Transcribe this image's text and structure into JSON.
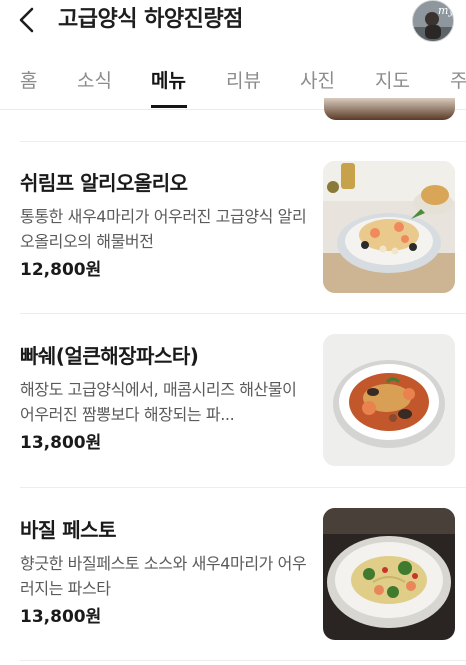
{
  "header": {
    "title": "고급양식 하양진량점",
    "back_icon": "chevron-left-icon",
    "profile_badge": "my"
  },
  "tabs": [
    {
      "label": "홈",
      "active": false
    },
    {
      "label": "소식",
      "active": false
    },
    {
      "label": "메뉴",
      "active": true
    },
    {
      "label": "리뷰",
      "active": false
    },
    {
      "label": "사진",
      "active": false
    },
    {
      "label": "지도",
      "active": false
    },
    {
      "label": "주",
      "active": false
    }
  ],
  "menu": [
    {
      "name": "쉬림프 알리오올리오",
      "description": "통통한 새우4마리가 어우러진 고급양식 알리오올리오의 해물버전",
      "price": "12,800원"
    },
    {
      "name": "빠쉐(얼큰해장파스타)",
      "description": "해장도 고급양식에서, 매콤시리즈 해산물이 어우러진 짬뽕보다 해장되는 파...",
      "price": "13,800원"
    },
    {
      "name": "바질 페스토",
      "description": "향긋한 바질페스토 소스와 새우4마리가 어우러지는 파스타",
      "price": "13,800원"
    }
  ],
  "colors": {
    "text_primary": "#1a1a1a",
    "text_secondary": "#5b5b5b",
    "tab_inactive": "#8c8c8c",
    "divider": "#ededed"
  }
}
